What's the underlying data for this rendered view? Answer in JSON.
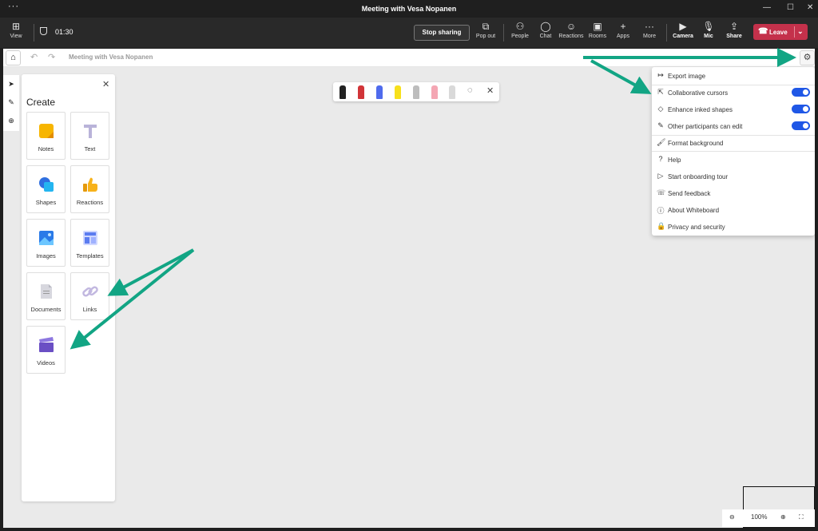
{
  "window": {
    "title": "Meeting with Vesa Nopanen"
  },
  "toolbar": {
    "view": "View",
    "timer": "01:30",
    "stop_sharing": "Stop sharing",
    "pop_out": "Pop out",
    "people": "People",
    "chat": "Chat",
    "reactions": "Reactions",
    "rooms": "Rooms",
    "apps": "Apps",
    "more": "More",
    "camera": "Camera",
    "mic": "Mic",
    "share": "Share",
    "leave": "Leave"
  },
  "whiteboard": {
    "title": "Meeting with Vesa Nopanen",
    "zoom": "100%"
  },
  "create_panel": {
    "title": "Create",
    "items": [
      {
        "label": "Notes",
        "icon": "notes-icon"
      },
      {
        "label": "Text",
        "icon": "text-icon"
      },
      {
        "label": "Shapes",
        "icon": "shapes-icon"
      },
      {
        "label": "Reactions",
        "icon": "reactions-icon"
      },
      {
        "label": "Images",
        "icon": "images-icon"
      },
      {
        "label": "Templates",
        "icon": "templates-icon"
      },
      {
        "label": "Documents",
        "icon": "documents-icon"
      },
      {
        "label": "Links",
        "icon": "links-icon"
      },
      {
        "label": "Videos",
        "icon": "videos-icon"
      }
    ]
  },
  "pens": {
    "colors": [
      "#222222",
      "#d13438",
      "#4f6bed",
      "#f7e01c",
      "#bdbdbd",
      "#f4a6b3",
      "#d9d9d9"
    ]
  },
  "settings_menu": {
    "items": [
      {
        "label": "Export image",
        "icon": "export-icon"
      },
      {
        "label": "Collaborative cursors",
        "icon": "cursor-icon",
        "toggle": true
      },
      {
        "label": "Enhance inked shapes",
        "icon": "shapes-outline-icon",
        "toggle": true
      },
      {
        "label": "Other participants can edit",
        "icon": "pencil-icon",
        "toggle": true
      },
      {
        "label": "Format background",
        "icon": "brush-icon"
      },
      {
        "label": "Help",
        "icon": "help-icon"
      },
      {
        "label": "Start onboarding tour",
        "icon": "play-icon"
      },
      {
        "label": "Send feedback",
        "icon": "feedback-icon"
      },
      {
        "label": "About Whiteboard",
        "icon": "info-icon"
      },
      {
        "label": "Privacy and security",
        "icon": "lock-icon"
      }
    ]
  },
  "colors": {
    "accent": "#1f57e6",
    "leave": "#c4314b",
    "arrow": "#12a584"
  }
}
